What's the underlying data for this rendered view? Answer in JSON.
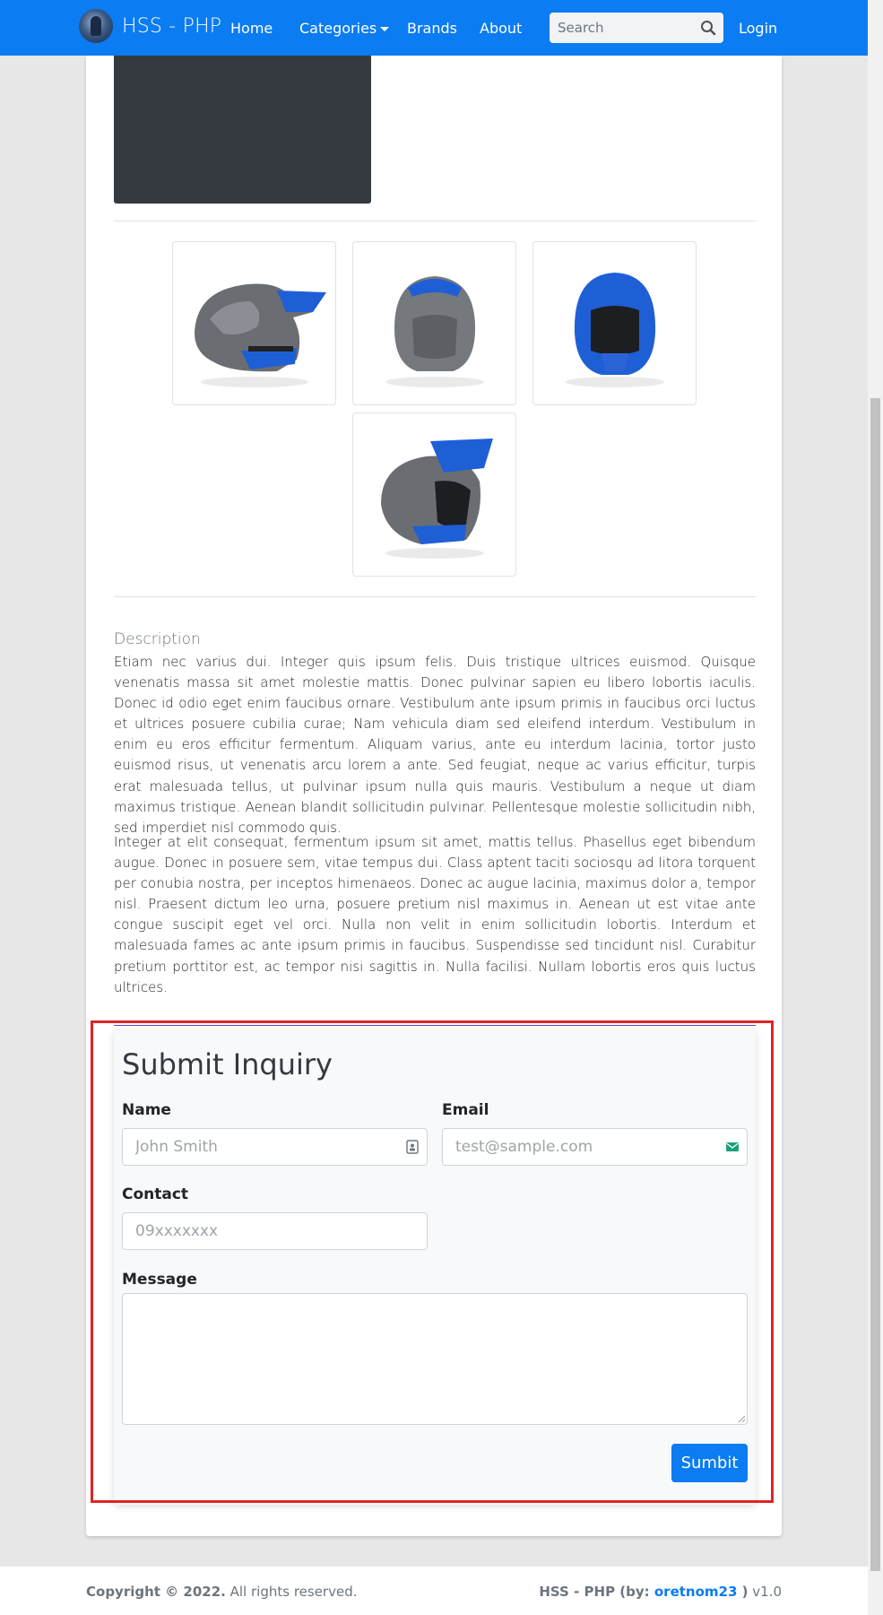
{
  "navbar": {
    "brand": "HSS - PHP",
    "links": {
      "home": "Home",
      "categories": "Categories",
      "brands": "Brands",
      "about": "About",
      "login": "Login"
    },
    "search": {
      "placeholder": "Search",
      "value": ""
    },
    "icons": {
      "logo": "brand-logo-icon",
      "search": "search-icon",
      "dropdown": "caret-down-icon"
    },
    "color": "#0b7cf2"
  },
  "product": {
    "thumbnails": [
      {
        "alt": "helmet-side-view"
      },
      {
        "alt": "helmet-back-view"
      },
      {
        "alt": "helmet-front-view"
      },
      {
        "alt": "helmet-angle-view"
      }
    ],
    "description_label": "Description",
    "description": [
      "Etiam nec varius dui. Integer quis ipsum felis. Duis tristique ultrices euismod. Quisque venenatis massa sit amet molestie mattis. Donec pulvinar sapien eu libero lobortis iaculis. Donec id odio eget enim faucibus ornare. Vestibulum ante ipsum primis in faucibus orci luctus et ultrices posuere cubilia curae; Nam vehicula diam sed eleifend interdum. Vestibulum in enim eu eros efficitur fermentum. Aliquam varius, ante eu interdum lacinia, tortor justo euismod risus, ut venenatis arcu lorem a ante. Sed feugiat, neque ac varius efficitur, turpis erat malesuada tellus, ut pulvinar ipsum nulla quis mauris. Vestibulum a neque ut diam maximus tristique. Aenean blandit sollicitudin pulvinar. Pellentesque molestie sollicitudin nibh, sed imperdiet nisl commodo quis.",
      "Integer at elit consequat, fermentum ipsum sit amet, mattis tellus. Phasellus eget bibendum augue. Donec in posuere sem, vitae tempus dui. Class aptent taciti sociosqu ad litora torquent per conubia nostra, per inceptos himenaeos. Donec ac augue lacinia, maximus dolor a, tempor nisl. Praesent dictum leo urna, posuere pretium nisl maximus in. Aenean ut est vitae ante congue suscipit eget vel orci. Nulla non velit in enim sollicitudin lobortis. Interdum et malesuada fames ac ante ipsum primis in faucibus. Suspendisse sed tincidunt nisl. Curabitur pretium porttitor est, ac tempor nisi sagittis in. Nulla facilisi. Nullam lobortis eros quis luctus ultrices."
    ]
  },
  "inquiry": {
    "title": "Submit Inquiry",
    "name": {
      "label": "Name",
      "placeholder": "John Smith",
      "value": "",
      "icon": "contact-card-icon"
    },
    "email": {
      "label": "Email",
      "placeholder": "test@sample.com",
      "value": "",
      "icon": "email-icon"
    },
    "contact": {
      "label": "Contact",
      "placeholder": "09xxxxxxx",
      "value": ""
    },
    "message": {
      "label": "Message",
      "value": ""
    },
    "submit_label": "Sumbit",
    "highlight_color": "#e02424"
  },
  "footer": {
    "copyright_prefix": "Copyright © 2022.",
    "copyright_suffix": " All rights reserved.",
    "credit_prefix": "HSS - PHP (by: ",
    "credit_author": "oretnom23",
    "credit_suffix": " )",
    "version": " v1.0"
  }
}
